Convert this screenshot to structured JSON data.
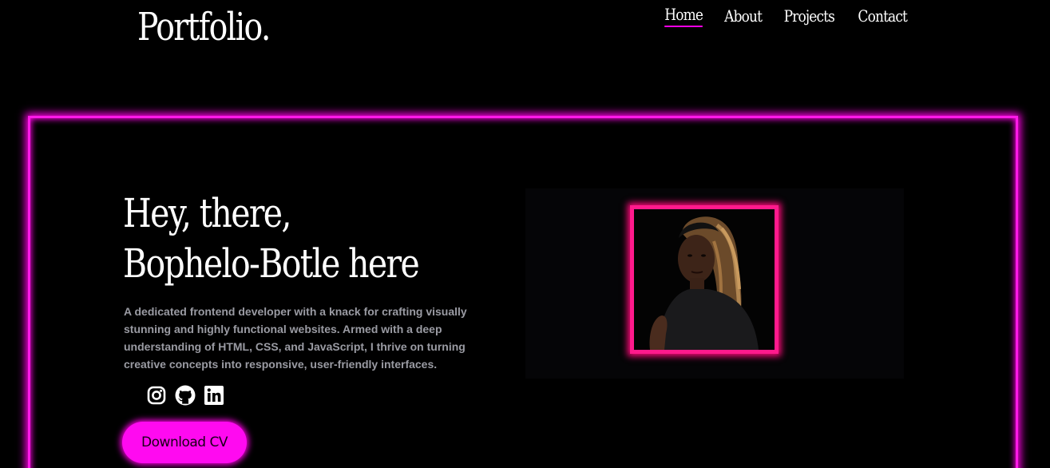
{
  "header": {
    "logo": "Portfolio.",
    "nav": [
      {
        "label": "Home",
        "active": true
      },
      {
        "label": "About",
        "active": false
      },
      {
        "label": "Projects",
        "active": false
      },
      {
        "label": "Contact",
        "active": false
      }
    ]
  },
  "hero": {
    "greeting_line1": "Hey, there,",
    "greeting_line2": "Bophelo-Botle here",
    "bio": "A dedicated frontend developer with a knack for crafting visually stunning and highly functional websites. Armed with a deep understanding of HTML, CSS, and JavaScript, I thrive on turning creative concepts into responsive, user-friendly interfaces.",
    "socials": [
      {
        "icon": "instagram-icon"
      },
      {
        "icon": "github-icon"
      },
      {
        "icon": "linkedin-icon"
      }
    ],
    "cv_button": "Download CV"
  },
  "colors": {
    "background": "#000000",
    "accent": "#ff00e6",
    "photo_frame": "#ff1a8c",
    "bio_text": "#9a9ba3"
  }
}
